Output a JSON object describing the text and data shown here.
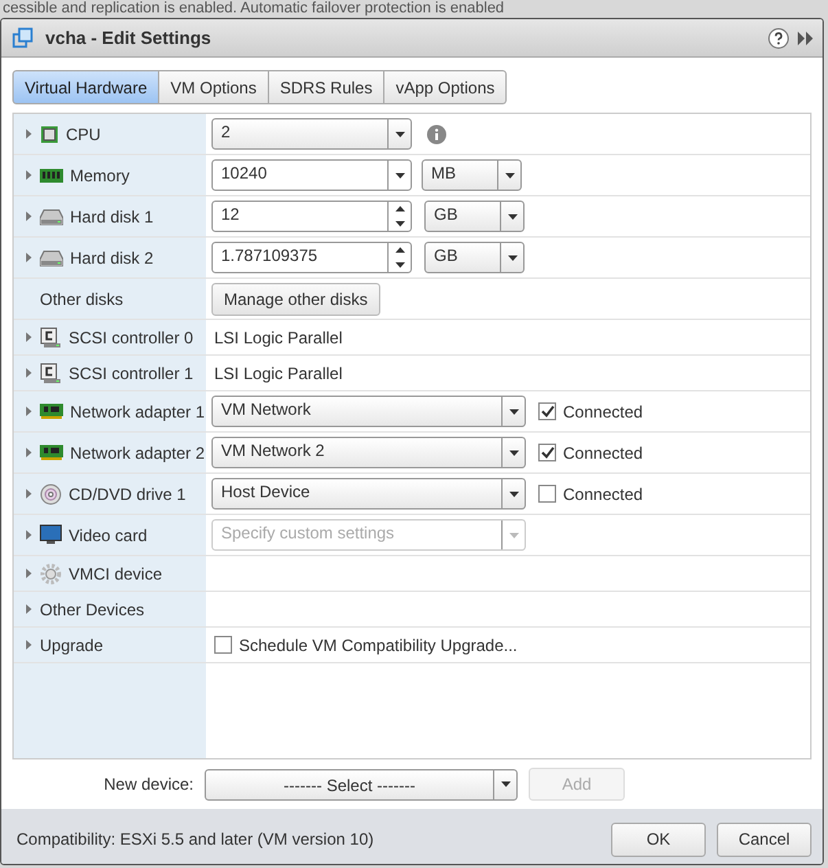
{
  "background_text": "cessible and replication is enabled. Automatic failover protection is enabled",
  "window": {
    "title": "vcha - Edit Settings"
  },
  "tabs": [
    {
      "label": "Virtual Hardware",
      "selected": true
    },
    {
      "label": "VM Options",
      "selected": false
    },
    {
      "label": "SDRS Rules",
      "selected": false
    },
    {
      "label": "vApp Options",
      "selected": false
    }
  ],
  "rows": [
    {
      "label": "CPU",
      "expandable": true,
      "kind": "cpu",
      "control": {
        "kind": "dropdown",
        "value": "2",
        "info": true
      }
    },
    {
      "label": "Memory",
      "expandable": true,
      "kind": "memory",
      "control": {
        "kind": "combo",
        "value": "10240",
        "unit": "MB"
      }
    },
    {
      "label": "Hard disk 1",
      "expandable": true,
      "kind": "disk",
      "control": {
        "kind": "spinner",
        "value": "12",
        "unit": "GB"
      }
    },
    {
      "label": "Hard disk 2",
      "expandable": true,
      "kind": "disk",
      "control": {
        "kind": "spinner",
        "value": "1.787109375",
        "unit": "GB"
      }
    },
    {
      "label": "Other disks",
      "expandable": false,
      "control": {
        "kind": "button",
        "value": "Manage other disks"
      }
    },
    {
      "label": "SCSI controller 0",
      "expandable": true,
      "kind": "scsi",
      "control": {
        "kind": "text",
        "value": "LSI Logic Parallel"
      }
    },
    {
      "label": "SCSI controller 1",
      "expandable": true,
      "kind": "scsi",
      "control": {
        "kind": "text",
        "value": "LSI Logic Parallel"
      }
    },
    {
      "label": "Network adapter 1",
      "expandable": true,
      "kind": "network",
      "control": {
        "kind": "wide-dropdown",
        "value": "VM Network",
        "disabled": false,
        "connected": {
          "label": "Connected",
          "checked": true
        }
      }
    },
    {
      "label": "Network adapter 2",
      "expandable": true,
      "kind": "network",
      "control": {
        "kind": "wide-dropdown",
        "value": "VM Network 2",
        "disabled": false,
        "connected": {
          "label": "Connected",
          "checked": true
        }
      }
    },
    {
      "label": "CD/DVD drive 1",
      "expandable": true,
      "kind": "cd",
      "control": {
        "kind": "wide-dropdown",
        "value": "Host Device",
        "disabled": false,
        "connected": {
          "label": "Connected",
          "checked": false
        }
      }
    },
    {
      "label": "Video card",
      "expandable": true,
      "kind": "monitor",
      "control": {
        "kind": "wide-dropdown",
        "value": "Specify custom settings",
        "disabled": true
      }
    },
    {
      "label": "VMCI device",
      "expandable": true,
      "kind": "gear"
    },
    {
      "label": "Other Devices",
      "expandable": true
    },
    {
      "label": "Upgrade",
      "expandable": true,
      "control": {
        "kind": "checkbox",
        "value": "Schedule VM Compatibility Upgrade...",
        "checked": false
      }
    }
  ],
  "new_device": {
    "label": "New device:",
    "value": "------- Select -------",
    "add": {
      "label": "Add",
      "disabled": true
    }
  },
  "compatibility": "Compatibility: ESXi 5.5 and later (VM version 10)",
  "buttons": [
    "OK",
    "Cancel"
  ]
}
